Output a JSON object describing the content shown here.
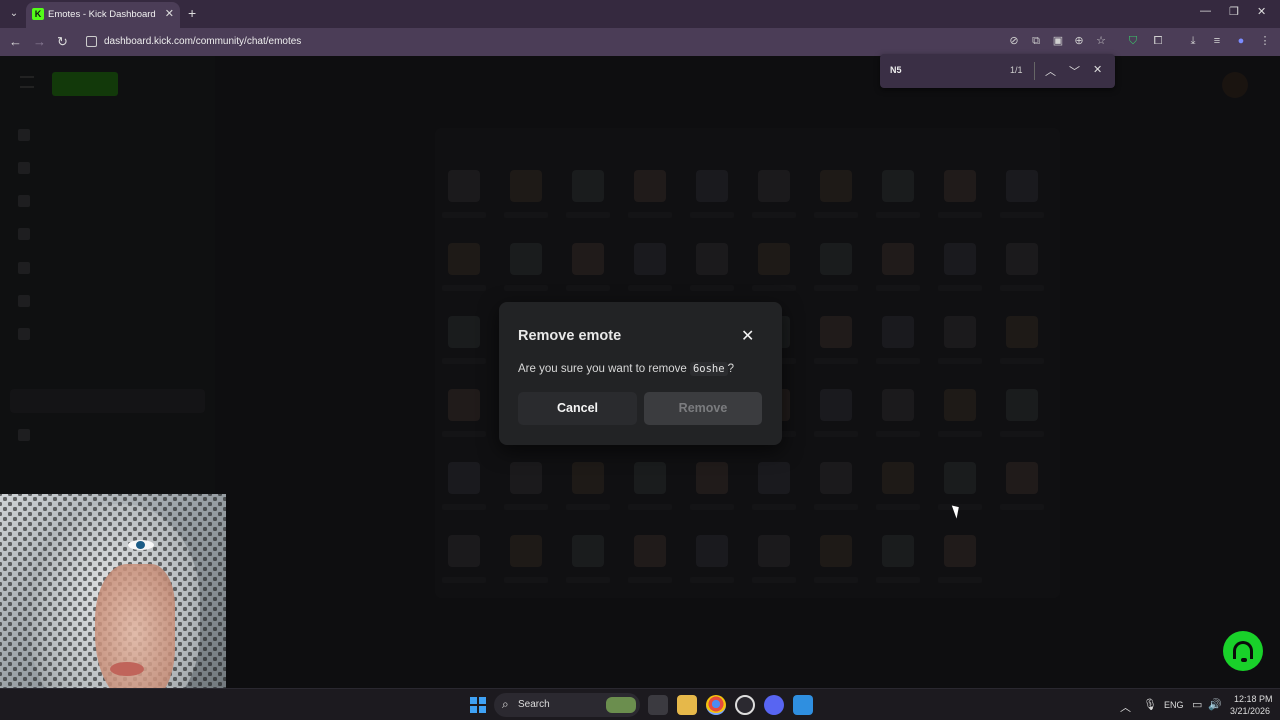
{
  "browser": {
    "tab_title": "Emotes - Kick Dashboard",
    "tab_favicon": "K",
    "url": "dashboard.kick.com/community/chat/emotes"
  },
  "findbar": {
    "query": "N5",
    "count": "1/1"
  },
  "modal": {
    "title": "Remove emote",
    "question_prefix": "Are you sure you want to remove",
    "emote_name": "6oshe",
    "question_suffix": "?",
    "cancel_label": "Cancel",
    "remove_label": "Remove"
  },
  "taskbar": {
    "search_label": "Search",
    "language": "ENG",
    "time": "12:18 PM",
    "date": "3/21/2026"
  },
  "colors": {
    "kick_green": "#53fc18",
    "modal_bg": "#222325",
    "tab_bg": "#35293f"
  }
}
